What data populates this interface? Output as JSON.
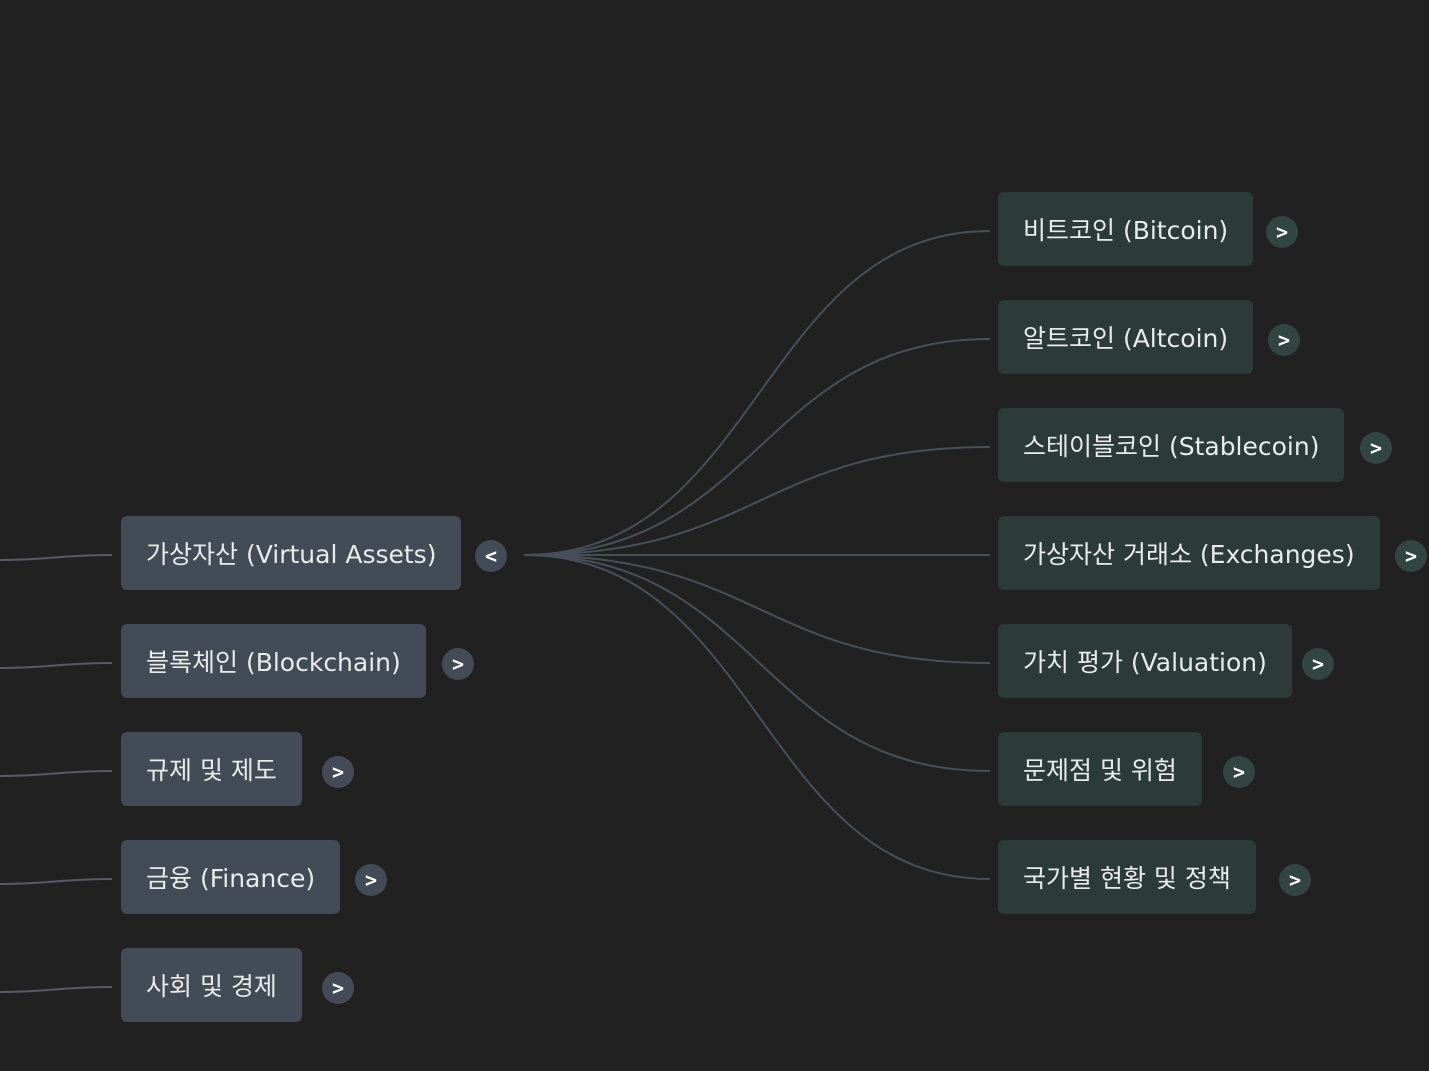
{
  "mindmap": {
    "left_column": [
      {
        "label": "가상자산 (Virtual Assets)",
        "toggle": "<"
      },
      {
        "label": "블록체인 (Blockchain)",
        "toggle": ">"
      },
      {
        "label": "규제 및 제도",
        "toggle": ">"
      },
      {
        "label": "금융 (Finance)",
        "toggle": ">"
      },
      {
        "label": "사회 및 경제",
        "toggle": ">"
      }
    ],
    "expanded_index": 0,
    "right_column": [
      {
        "label": "비트코인 (Bitcoin)",
        "toggle": ">"
      },
      {
        "label": "알트코인 (Altcoin)",
        "toggle": ">"
      },
      {
        "label": "스테이블코인 (Stablecoin)",
        "toggle": ">"
      },
      {
        "label": "가상자산 거래소 (Exchanges)",
        "toggle": ">"
      },
      {
        "label": "가치 평가 (Valuation)",
        "toggle": ">"
      },
      {
        "label": "문제점 및 위험",
        "toggle": ">"
      },
      {
        "label": "국가별 현황 및 정책",
        "toggle": ">"
      }
    ],
    "colors": {
      "background": "#212121",
      "level1_node": "#434b56",
      "level2_node": "#2c3b38",
      "left_edge": "#595868",
      "right_edge": "#47505a"
    }
  }
}
